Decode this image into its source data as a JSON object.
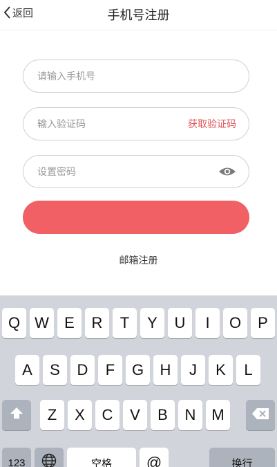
{
  "header": {
    "back_label": "返回",
    "title": "手机号注册"
  },
  "form": {
    "phone_placeholder": "请输入手机号",
    "code_placeholder": "输入验证码",
    "get_code_label": "获取验证码",
    "password_placeholder": "设置密码",
    "eye_icon": "eye-icon"
  },
  "actions": {
    "email_register_label": "邮箱注册"
  },
  "colors": {
    "accent": "#f06064",
    "link": "#e0575c",
    "keyboard_bg": "#d1d5db"
  },
  "keyboard": {
    "row1": [
      "Q",
      "W",
      "E",
      "R",
      "T",
      "Y",
      "U",
      "I",
      "O",
      "P"
    ],
    "row2": [
      "A",
      "S",
      "D",
      "F",
      "G",
      "H",
      "J",
      "K",
      "L"
    ],
    "row3": [
      "Z",
      "X",
      "C",
      "V",
      "B",
      "N",
      "M"
    ],
    "shift_icon": "shift-icon",
    "delete_icon": "backspace-icon",
    "num_label": "123",
    "globe_icon": "globe-icon",
    "space_label": "空格",
    "at_label": "@",
    "return_label": "换行"
  }
}
